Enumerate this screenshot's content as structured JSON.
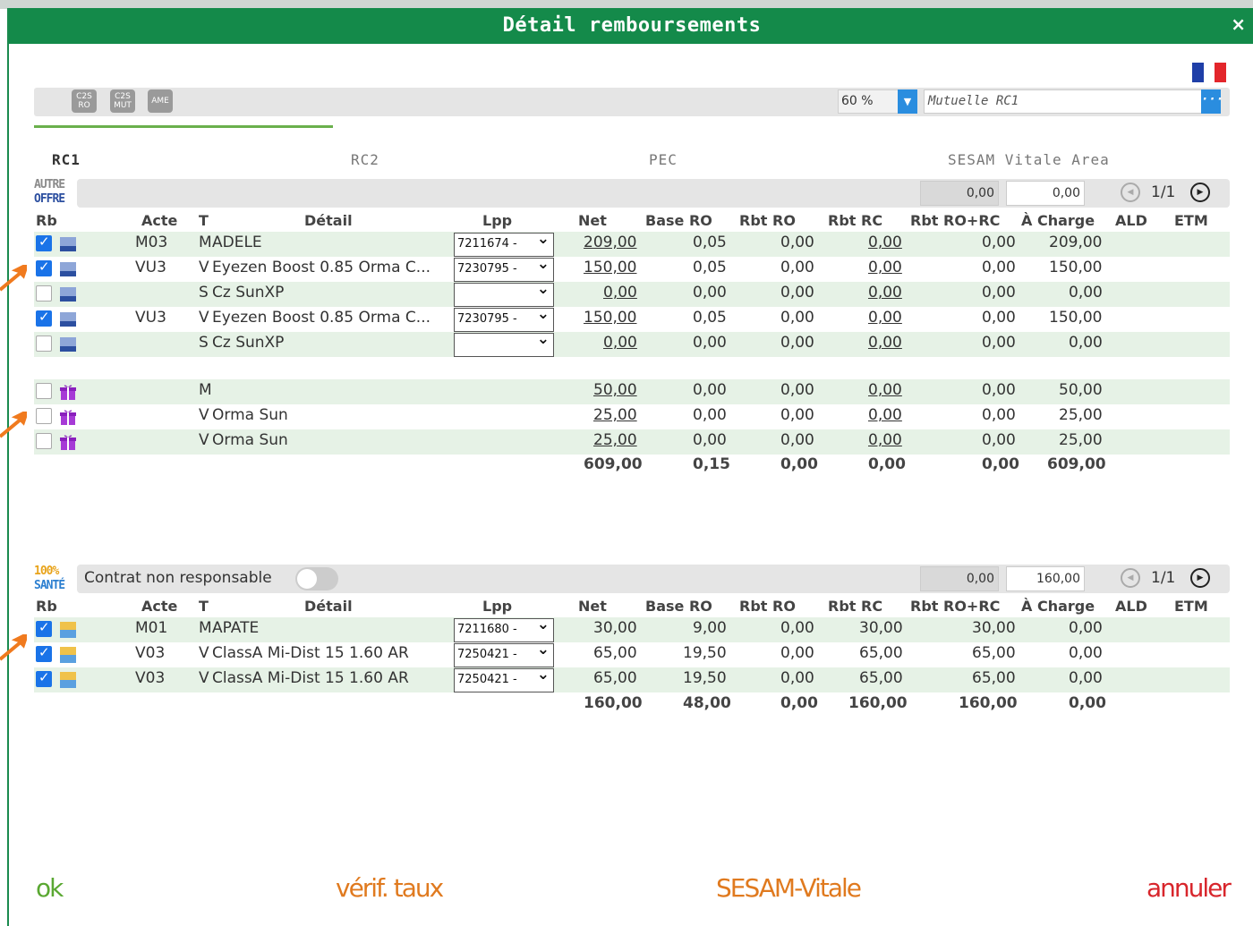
{
  "dialog": {
    "title": "Détail remboursements",
    "close_label": "×"
  },
  "toolbar": {
    "buttons": [
      "C2S RO",
      "C2S MUT",
      "AME"
    ],
    "rate_value": "60 %",
    "mutuelle_placeholder": "Mutuelle RC1",
    "mutuelle_button": "···"
  },
  "tabs": [
    "RC1",
    "RC2",
    "PEC",
    "SESAM Vitale Area"
  ],
  "columns": [
    "Rb",
    "Acte",
    "T",
    "Détail",
    "Lpp",
    "Net",
    "Base RO",
    "Rbt RO",
    "Rbt RC",
    "Rbt RO+RC",
    "À Charge",
    "ALD",
    "ETM"
  ],
  "section1": {
    "logo_line1": "AUTRE",
    "logo_line2": "OFFRE",
    "total1": "0,00",
    "total2": "0,00",
    "pager": "1/1",
    "rows": [
      {
        "checked": true,
        "icon": "offre-icon",
        "acte": "M03",
        "t": "M",
        "detail": "ADELE",
        "lpp": "7211674 -",
        "net": "209,00",
        "base_ro": "0,05",
        "rbt_ro": "0,00",
        "rbt_rc": "0,00",
        "rbt_ro_rc": "0,00",
        "a_charge": "209,00"
      },
      {
        "checked": true,
        "icon": "offre-icon",
        "acte": "VU3",
        "t": "V",
        "detail": "Eyezen Boost 0.85 Orma C...",
        "lpp": "7230795 -",
        "net": "150,00",
        "base_ro": "0,05",
        "rbt_ro": "0,00",
        "rbt_rc": "0,00",
        "rbt_ro_rc": "0,00",
        "a_charge": "150,00"
      },
      {
        "checked": false,
        "icon": "offre-icon",
        "acte": "",
        "t": "S",
        "detail": "Cz SunXP",
        "lpp": "",
        "net": "0,00",
        "base_ro": "0,00",
        "rbt_ro": "0,00",
        "rbt_rc": "0,00",
        "rbt_ro_rc": "0,00",
        "a_charge": "0,00"
      },
      {
        "checked": true,
        "icon": "offre-icon",
        "acte": "VU3",
        "t": "V",
        "detail": "Eyezen Boost 0.85 Orma C...",
        "lpp": "7230795 -",
        "net": "150,00",
        "base_ro": "0,05",
        "rbt_ro": "0,00",
        "rbt_rc": "0,00",
        "rbt_ro_rc": "0,00",
        "a_charge": "150,00"
      },
      {
        "checked": false,
        "icon": "offre-icon",
        "acte": "",
        "t": "S",
        "detail": "Cz SunXP",
        "lpp": "",
        "net": "0,00",
        "base_ro": "0,00",
        "rbt_ro": "0,00",
        "rbt_rc": "0,00",
        "rbt_ro_rc": "0,00",
        "a_charge": "0,00"
      }
    ],
    "gift_rows": [
      {
        "checked": false,
        "t": "M",
        "detail": "",
        "net": "50,00",
        "base_ro": "0,00",
        "rbt_ro": "0,00",
        "rbt_rc": "0,00",
        "rbt_ro_rc": "0,00",
        "a_charge": "50,00"
      },
      {
        "checked": false,
        "t": "V",
        "detail": "Orma Sun",
        "net": "25,00",
        "base_ro": "0,00",
        "rbt_ro": "0,00",
        "rbt_rc": "0,00",
        "rbt_ro_rc": "0,00",
        "a_charge": "25,00"
      },
      {
        "checked": false,
        "t": "V",
        "detail": "Orma Sun",
        "net": "25,00",
        "base_ro": "0,00",
        "rbt_ro": "0,00",
        "rbt_rc": "0,00",
        "rbt_ro_rc": "0,00",
        "a_charge": "25,00"
      }
    ],
    "totals": {
      "net": "609,00",
      "base_ro": "0,15",
      "rbt_ro": "0,00",
      "rbt_rc": "0,00",
      "rbt_ro_rc": "0,00",
      "a_charge": "609,00"
    }
  },
  "section2": {
    "logo_line1": "100%",
    "logo_line2": "SANTÉ",
    "contract_label": "Contrat non responsable",
    "total1": "0,00",
    "total2": "160,00",
    "pager": "1/1",
    "rows": [
      {
        "checked": true,
        "acte": "M01",
        "t": "M",
        "detail": "APATE",
        "lpp": "7211680 -",
        "net": "30,00",
        "base_ro": "9,00",
        "rbt_ro": "0,00",
        "rbt_rc": "30,00",
        "rbt_ro_rc": "30,00",
        "a_charge": "0,00"
      },
      {
        "checked": true,
        "acte": "V03",
        "t": "V",
        "detail": "ClassA Mi-Dist 15 1.60 AR",
        "lpp": "7250421 -",
        "net": "65,00",
        "base_ro": "19,50",
        "rbt_ro": "0,00",
        "rbt_rc": "65,00",
        "rbt_ro_rc": "65,00",
        "a_charge": "0,00"
      },
      {
        "checked": true,
        "acte": "V03",
        "t": "V",
        "detail": "ClassA Mi-Dist 15 1.60 AR",
        "lpp": "7250421 -",
        "net": "65,00",
        "base_ro": "19,50",
        "rbt_ro": "0,00",
        "rbt_rc": "65,00",
        "rbt_ro_rc": "65,00",
        "a_charge": "0,00"
      }
    ],
    "totals": {
      "net": "160,00",
      "base_ro": "48,00",
      "rbt_ro": "0,00",
      "rbt_rc": "160,00",
      "rbt_ro_rc": "160,00",
      "a_charge": "0,00"
    }
  },
  "footer": {
    "ok": "ok",
    "verif": "vérif. taux",
    "sesam": "SESAM-Vitale",
    "annuler": "annuler"
  },
  "colors": {
    "titlebar": "#148a4a",
    "row_alt": "#e6f2e6",
    "ok": "#5aa832",
    "verif": "#e07a1f",
    "annuler": "#d8262c",
    "arrow": "#f07a1e"
  }
}
